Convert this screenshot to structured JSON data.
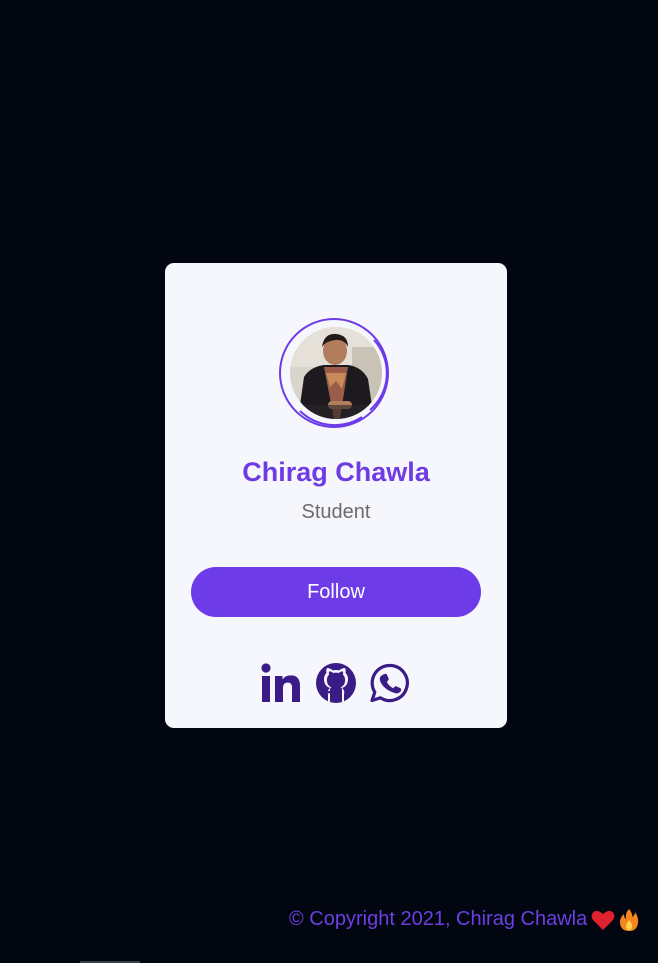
{
  "profile": {
    "name": "Chirag Chawla",
    "role": "Student",
    "follow_label": "Follow"
  },
  "socials": [
    {
      "icon": "linkedin-icon"
    },
    {
      "icon": "github-icon"
    },
    {
      "icon": "whatsapp-icon"
    }
  ],
  "footer": {
    "text": "© Copyright 2021, Chirag Chawla",
    "emojis": [
      "heart-icon",
      "fire-icon"
    ]
  },
  "colors": {
    "page_background": "#020611",
    "card_background": "#f6f7fc",
    "accent": "#6d3be8",
    "social_icon": "#3b1b86",
    "role_text": "#6b6b6b"
  }
}
